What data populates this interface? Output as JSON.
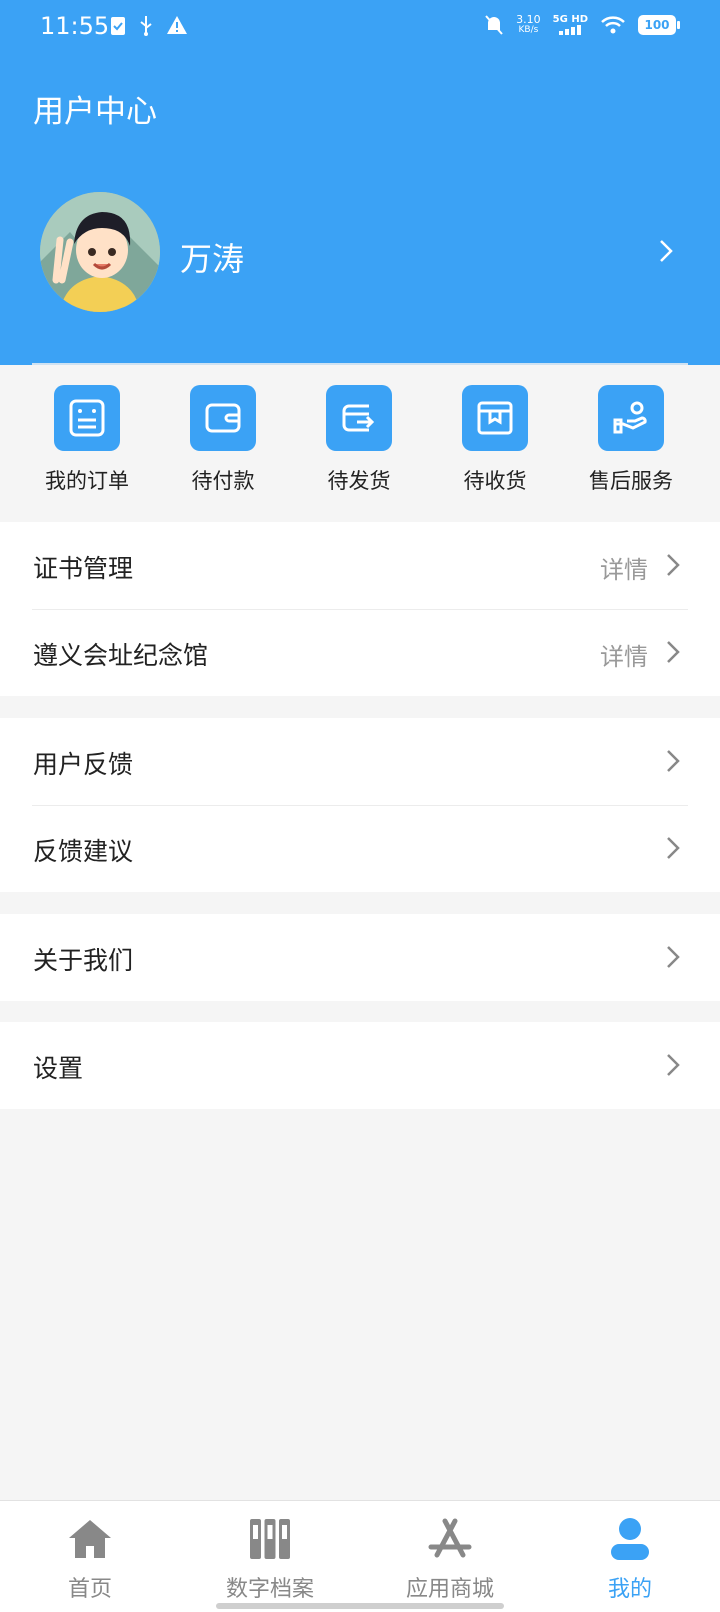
{
  "status_bar": {
    "time": "11:55",
    "net_speed": "3.10",
    "net_unit": "KB/s",
    "network": "5G HD",
    "battery": "100"
  },
  "header": {
    "title": "用户中心",
    "user_name": "万涛"
  },
  "shortcuts": [
    {
      "label": "我的订单",
      "icon": "order-list-icon"
    },
    {
      "label": "待付款",
      "icon": "wallet-icon"
    },
    {
      "label": "待发货",
      "icon": "shipping-icon"
    },
    {
      "label": "待收货",
      "icon": "package-icon"
    },
    {
      "label": "售后服务",
      "icon": "after-sales-icon"
    }
  ],
  "menu_groups": [
    [
      {
        "label": "证书管理",
        "detail": "详情"
      },
      {
        "label": "遵义会址纪念馆",
        "detail": "详情"
      }
    ],
    [
      {
        "label": "用户反馈"
      },
      {
        "label": "反馈建议"
      }
    ],
    [
      {
        "label": "关于我们"
      }
    ],
    [
      {
        "label": "设置"
      }
    ]
  ],
  "tabbar": {
    "active": 3,
    "tabs": [
      {
        "label": "首页",
        "icon": "home-icon"
      },
      {
        "label": "数字档案",
        "icon": "archive-icon"
      },
      {
        "label": "应用商城",
        "icon": "app-store-icon"
      },
      {
        "label": "我的",
        "icon": "user-icon"
      }
    ]
  },
  "colors": {
    "accent": "#3ba2f5",
    "background": "#f5f5f5"
  }
}
